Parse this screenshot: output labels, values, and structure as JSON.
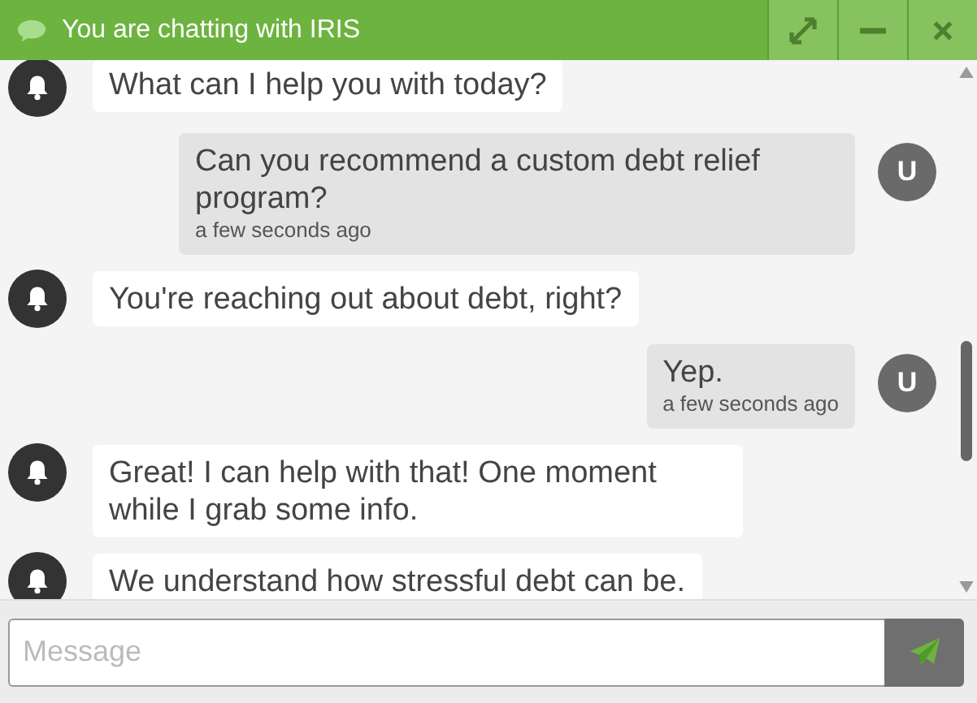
{
  "header": {
    "title": "You are chatting with IRIS"
  },
  "messages": [
    {
      "kind": "bot",
      "text": "What can I help you with today?"
    },
    {
      "kind": "user",
      "text": "Can you recommend a custom debt relief program?",
      "time": "a few seconds ago",
      "avatar": "U"
    },
    {
      "kind": "bot",
      "text": "You're reaching out about debt, right?"
    },
    {
      "kind": "user",
      "text": "Yep.",
      "time": "a few seconds ago",
      "avatar": "U"
    },
    {
      "kind": "bot",
      "text": "Great! I can help with that! One moment while I grab some info."
    },
    {
      "kind": "bot",
      "text": "We understand how stressful debt can be."
    }
  ],
  "composer": {
    "placeholder": "Message"
  }
}
